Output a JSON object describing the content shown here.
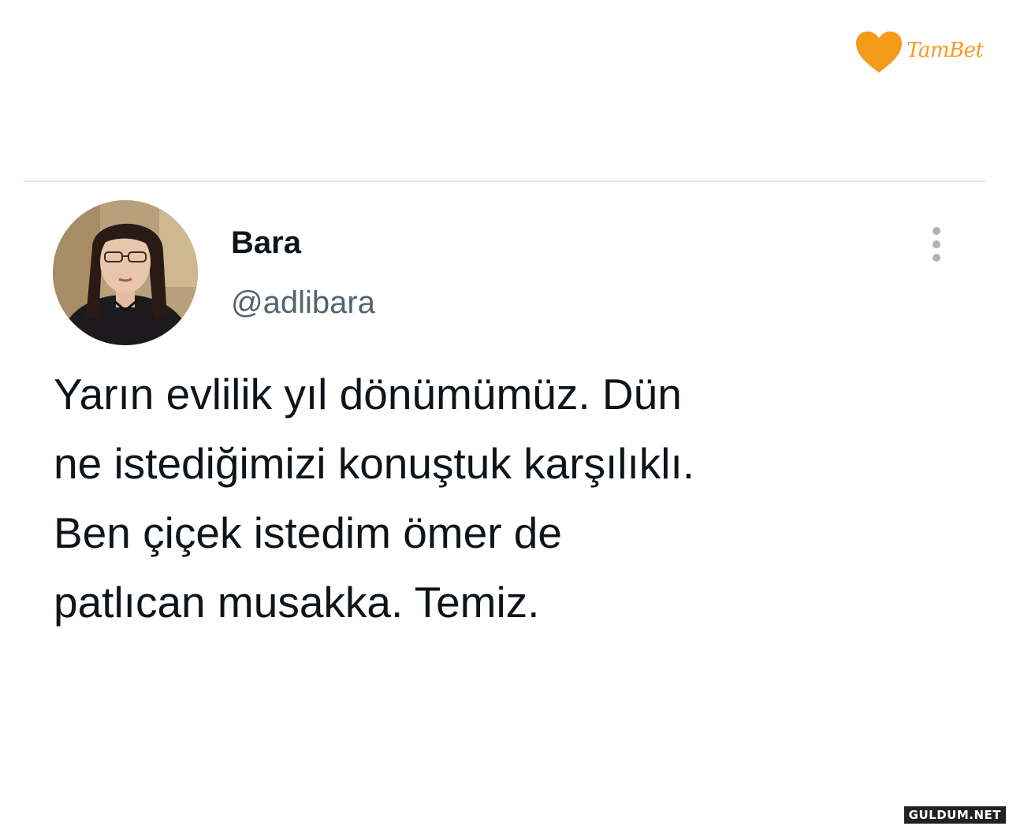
{
  "brand": {
    "name": "TamBet",
    "logo_icon": "heart-icon",
    "color": "#f59a1b"
  },
  "tweet": {
    "author": {
      "display_name": "Bara",
      "handle": "@adlibara",
      "avatar": "avatar-photo"
    },
    "menu_icon": "more-vertical-icon",
    "text_lines": [
      "Yarın evlilik yıl dönümümüz. Dün",
      "ne istediğimizi konuştuk karşılıklı.",
      "Ben çiçek istedim ömer de",
      "patlıcan musakka. Temiz."
    ]
  },
  "watermark": {
    "text": "GULDUM.NET"
  },
  "colors": {
    "text_primary": "#0f1419",
    "text_secondary": "#536471",
    "divider": "#e3e6e8",
    "dots": "#a9b4bd"
  }
}
